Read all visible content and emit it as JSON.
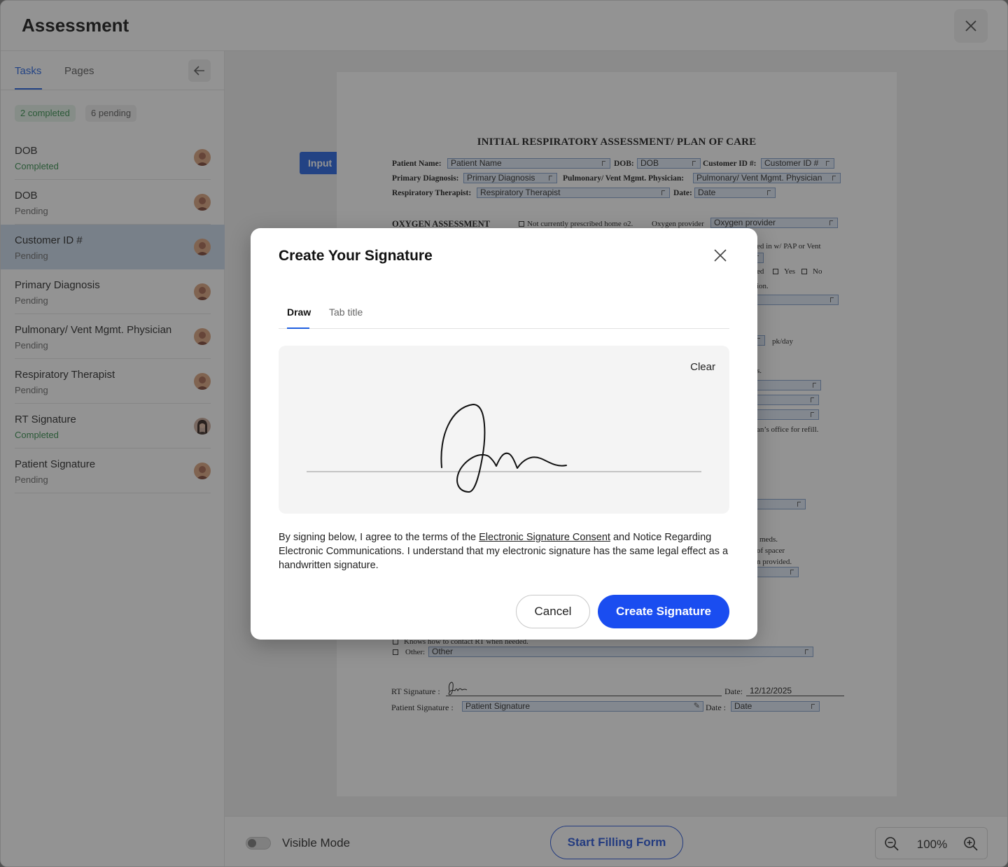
{
  "header": {
    "title": "Assessment"
  },
  "sidebar": {
    "tabs": [
      {
        "label": "Tasks"
      },
      {
        "label": "Pages"
      }
    ],
    "badges": {
      "completed": "2 completed",
      "pending": "6 pending"
    },
    "tasks": [
      {
        "title": "DOB",
        "status": "Completed"
      },
      {
        "title": "DOB",
        "status": "Pending"
      },
      {
        "title": "Customer ID #",
        "status": "Pending"
      },
      {
        "title": "Primary Diagnosis",
        "status": "Pending"
      },
      {
        "title": "Pulmonary/ Vent Mgmt. Physician",
        "status": "Pending"
      },
      {
        "title": "Respiratory Therapist",
        "status": "Pending"
      },
      {
        "title": "RT Signature",
        "status": "Completed"
      },
      {
        "title": "Patient Signature",
        "status": "Pending"
      }
    ]
  },
  "document": {
    "title": "INITIAL RESPIRATORY ASSESSMENT/ PLAN OF CARE",
    "input_tag": "Input",
    "labels": {
      "patient_name": "Patient Name:",
      "dob": "DOB:",
      "customer_id": "Customer ID #:",
      "primary_diagnosis": "Primary Diagnosis:",
      "physician": "Pulmonary/ Vent Mgmt. Physician:",
      "therapist": "Respiratory Therapist:",
      "date": "Date:",
      "oxygen_assessment": "OXYGEN ASSESSMENT",
      "not_prescribed": "Not currently prescribed home o2.",
      "oxygen_provider": "Oxygen provider",
      "other": "Other:",
      "rt_signature": "RT Signature :",
      "date2": "Date:",
      "patient_signature": "Patient Signature :",
      "date3": "Date :"
    },
    "fields": {
      "patient_name": "Patient Name",
      "dob": "DOB",
      "customer_id": "Customer ID #",
      "primary_diagnosis": "Primary Diagnosis",
      "physician": "Pulmonary/ Vent Mgmt. Physician",
      "therapist": "Respiratory Therapist",
      "date": "Date",
      "oxygen_provider": "Oxygen provider",
      "other": "Other",
      "rt_date": "12/12/2025",
      "patient_signature": "Patient Signature",
      "patient_date": "Date"
    },
    "fragments": {
      "pap": "ed in w/ PAP or Vent",
      "ed": "ed",
      "yes": "Yes",
      "no": "No",
      "ion": "ion.",
      "pkday": "pk/day",
      "s": "s.",
      "refill": "an’s office for refill.",
      "meds": "meds.",
      "spacer": "of spacer",
      "provided": "n provided.",
      "knows": "Knows how to contact RT when needed."
    }
  },
  "bottom_bar": {
    "visible_mode": "Visible Mode",
    "start_button": "Start Filling Form",
    "zoom": "100%"
  },
  "modal": {
    "title": "Create Your Signature",
    "tabs": [
      {
        "label": "Draw"
      },
      {
        "label": "Tab title"
      }
    ],
    "clear": "Clear",
    "consent_before": "By signing below, I agree to the terms of the ",
    "consent_link": "Electronic Signature Consent",
    "consent_after": " and Notice Regarding Electronic Communications. I understand that my electronic signature has the same legal effect as a handwritten signature.",
    "cancel": "Cancel",
    "create": "Create Signature"
  },
  "colors": {
    "accent": "#1f5fe0",
    "primary_button": "#1a4df0",
    "completed": "#2e8a47",
    "selected_row": "#c9d8ea"
  },
  "icons": {
    "close": "close-icon",
    "collapse": "arrow-left-icon",
    "zoom_out": "zoom-out-icon",
    "zoom_in": "zoom-in-icon",
    "edit": "pencil-icon"
  }
}
